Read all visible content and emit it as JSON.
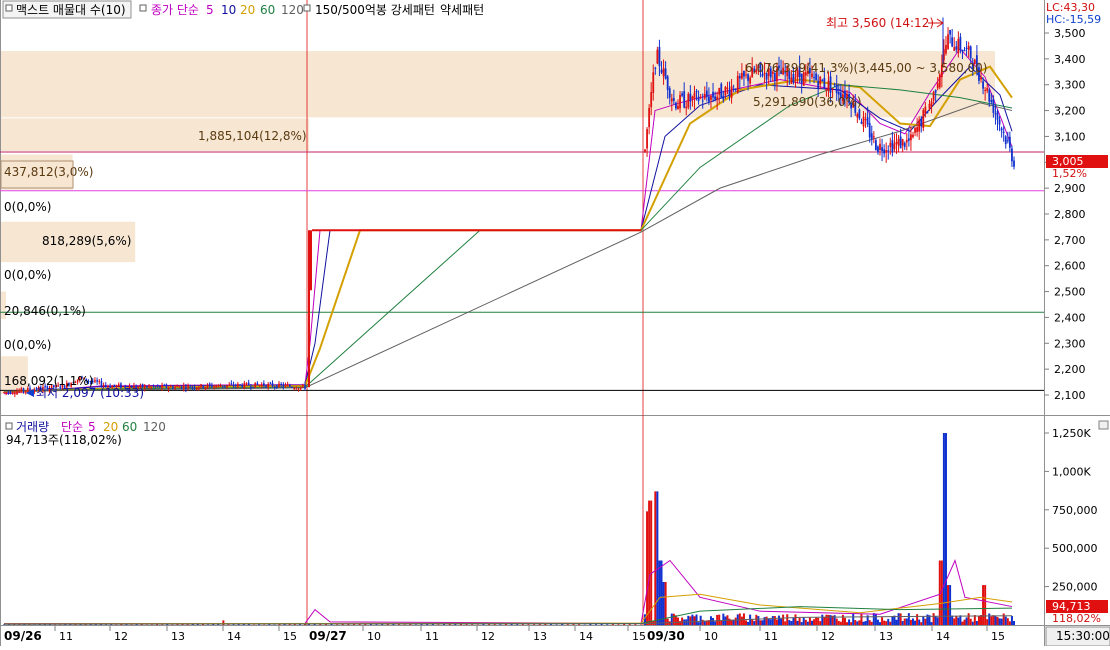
{
  "price_header": {
    "title": "맥스트 매물대 수(10)",
    "ma_label": "종가 단순",
    "ma_periods": [
      "5",
      "10",
      "20",
      "60",
      "120"
    ],
    "ma_colors": [
      "#c000c0",
      "#1010a0",
      "#d4a000",
      "#208040",
      "#606060"
    ],
    "pattern_label": "150/500억봉 강세패턴",
    "pattern_weak_label": "약세패턴"
  },
  "lc_label": "LC:43,30",
  "hc_label": "HC:-15,59",
  "high_annotation": "최고 3,560 (14:12)",
  "low_annotation": "최저 2,097 (10:33)",
  "current_price": "3,005",
  "current_change": "1,52%",
  "volume_header": {
    "title": "거래량",
    "ma_label": "단순",
    "ma_periods": [
      "5",
      "20",
      "60",
      "120"
    ],
    "ma_colors": [
      "#c000c0",
      "#d4a000",
      "#208040",
      "#606060"
    ]
  },
  "volume_readout": "94,713주(118,02%)",
  "current_volume": "94,713",
  "current_volume_pct": "118,02%",
  "time_readout": "15:30:00",
  "chart_data": {
    "type": "candlestick",
    "price_axis": {
      "min": 2050,
      "max": 3560,
      "ticks": [
        2100,
        2200,
        2300,
        2400,
        2500,
        2600,
        2700,
        2800,
        2900,
        3000,
        3100,
        3200,
        3300,
        3400,
        3500
      ],
      "tick_labels": [
        "2,100",
        "2,200",
        "2,300",
        "2,400",
        "2,500",
        "2,600",
        "2,700",
        "2,800",
        "2,900",
        "3,000",
        "3,100",
        "3,200",
        "3,300",
        "3,400",
        "3,500"
      ]
    },
    "volume_axis": {
      "min": 0,
      "max": 1300000,
      "ticks": [
        250000,
        500000,
        750000,
        1000000,
        1250000
      ],
      "tick_labels": [
        "250,000",
        "500,000",
        "750,000",
        "1,000K",
        "1,250K"
      ]
    },
    "x_axis": {
      "dates": [
        {
          "label": "09/26",
          "hours": [
            "11",
            "12",
            "13",
            "14",
            "15"
          ]
        },
        {
          "label": "09/27",
          "hours": [
            "10",
            "11",
            "12",
            "13",
            "14",
            "15"
          ]
        },
        {
          "label": "09/30",
          "hours": [
            "10",
            "11",
            "12",
            "13",
            "14",
            "15"
          ]
        }
      ]
    },
    "reference_lines": [
      {
        "value": 3040,
        "color": "#c02060"
      },
      {
        "value": 2890,
        "color": "#e040e0"
      },
      {
        "value": 2420,
        "color": "#208040"
      },
      {
        "value": 2118,
        "color": "#000000"
      }
    ],
    "volume_profile": [
      {
        "label": "6,076,399(41,3%)(3,445,00 ~ 3,580,00)",
        "price_low": 3170,
        "price_high": 3430
      },
      {
        "label": "5,291,890(36,0%)",
        "price_low": 3170,
        "price_high": 3430
      },
      {
        "label": "1,885,104(12,8%)",
        "price_low": 3040,
        "price_high": 3170
      },
      {
        "label": "437,812(3,0%)",
        "price_low": 2890,
        "price_high": 3030
      },
      {
        "label": "0(0,0%)",
        "price_low": 2780,
        "price_high": 2890
      },
      {
        "label": "818,289(5,6%)",
        "price_low": 2610,
        "price_high": 2770
      },
      {
        "label": "0(0,0%)",
        "price_low": 2500,
        "price_high": 2610
      },
      {
        "label": "20,846(0,1%)",
        "price_low": 2390,
        "price_high": 2500
      },
      {
        "label": "0(0,0%)",
        "price_low": 2250,
        "price_high": 2390
      },
      {
        "label": "168,092(1,1%)",
        "price_low": 2100,
        "price_high": 2250
      }
    ],
    "session_close_prices": [
      {
        "session": "09/26",
        "close": 2125
      },
      {
        "session": "09/27",
        "close": 2737
      },
      {
        "session": "09/30",
        "close": 3005
      }
    ],
    "session_high": 3560,
    "session_low": 2097
  }
}
